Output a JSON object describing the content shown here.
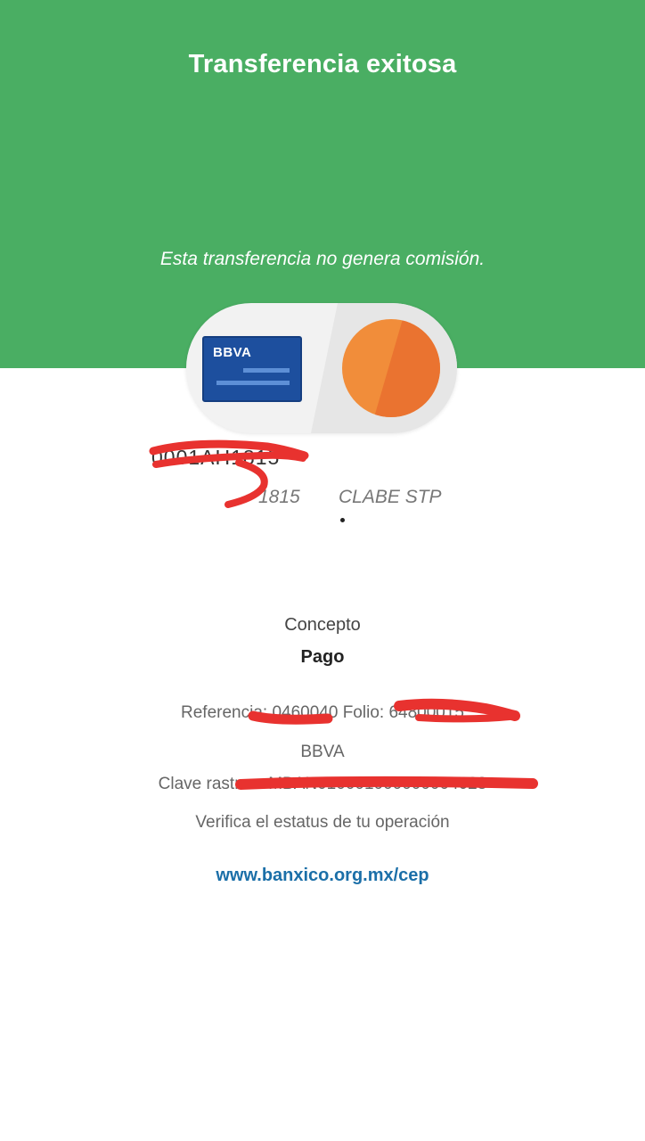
{
  "header": {
    "title": "Transferencia exitosa",
    "subtitle": "Esta transferencia no genera comisión."
  },
  "transfer_card": {
    "bank_card_label": "BBVA",
    "icon_left": "bank-card-icon",
    "icon_right": "orange-circle-icon"
  },
  "destination": {
    "account_number": "0001AH1815",
    "account_short": "1815",
    "account_type": "CLABE STP"
  },
  "details": {
    "concept_label": "Concepto",
    "concept_value": "Pago",
    "reference_line": "Referencia: 0460040 Folio: 64800015",
    "bank_name": "BBVA",
    "tracking_line": "Clave rastreo: MBAN010001000000004028",
    "verify_text": "Verifica el estatus de tu operación",
    "verify_link": "www.banxico.org.mx/cep"
  },
  "colors": {
    "header_green": "#4aae63",
    "bank_blue": "#1d4f9e",
    "orange": "#f18d3a",
    "link_blue": "#1b6fa8",
    "redaction_red": "#e8322f"
  }
}
